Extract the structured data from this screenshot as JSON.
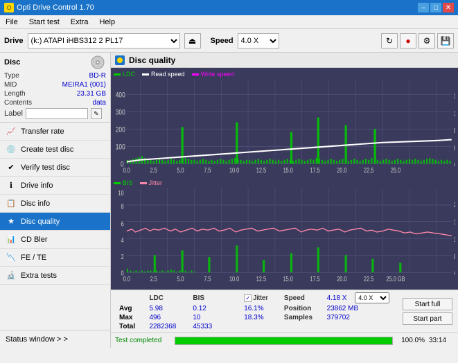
{
  "app": {
    "title": "Opti Drive Control 1.70",
    "icon": "disc"
  },
  "titlebar": {
    "title": "Opti Drive Control 1.70",
    "minimize": "–",
    "maximize": "□",
    "close": "✕"
  },
  "menubar": {
    "items": [
      "File",
      "Start test",
      "Extra",
      "Help"
    ]
  },
  "toolbar": {
    "drive_label": "Drive",
    "drive_value": "(k:) ATAPI iHBS312  2 PL17",
    "speed_label": "Speed",
    "speed_value": "4.0 X",
    "start_test_label": "Start test"
  },
  "disc": {
    "title": "Disc",
    "type_label": "Type",
    "type_value": "BD-R",
    "mid_label": "MID",
    "mid_value": "MEIRA1 (001)",
    "length_label": "Length",
    "length_value": "23.31 GB",
    "contents_label": "Contents",
    "contents_value": "data",
    "label_label": "Label",
    "label_value": ""
  },
  "sidebar": {
    "items": [
      {
        "id": "transfer-rate",
        "label": "Transfer rate",
        "icon": "📈"
      },
      {
        "id": "create-test-disc",
        "label": "Create test disc",
        "icon": "💿"
      },
      {
        "id": "verify-test-disc",
        "label": "Verify test disc",
        "icon": "✔"
      },
      {
        "id": "drive-info",
        "label": "Drive info",
        "icon": "ℹ"
      },
      {
        "id": "disc-info",
        "label": "Disc info",
        "icon": "📋"
      },
      {
        "id": "disc-quality",
        "label": "Disc quality",
        "icon": "★",
        "active": true
      },
      {
        "id": "cd-bler",
        "label": "CD Bler",
        "icon": "📊"
      },
      {
        "id": "fe-te",
        "label": "FE / TE",
        "icon": "📉"
      },
      {
        "id": "extra-tests",
        "label": "Extra tests",
        "icon": "🔬"
      }
    ],
    "status_window": "Status window > >"
  },
  "disc_quality": {
    "title": "Disc quality",
    "legend_upper": [
      {
        "label": "LDC",
        "color": "#00cc00"
      },
      {
        "label": "Read speed",
        "color": "#ffffff"
      },
      {
        "label": "Write speed",
        "color": "#ff00ff"
      }
    ],
    "legend_lower": [
      {
        "label": "BIS",
        "color": "#00cc00"
      },
      {
        "label": "Jitter",
        "color": "#ff88aa"
      }
    ],
    "upper_ymax": 500,
    "upper_yright": 18,
    "lower_ymax": 10,
    "lower_yright": 20,
    "xmax": 25.0
  },
  "stats": {
    "headers": [
      "",
      "LDC",
      "BIS",
      "",
      "Jitter",
      "Speed",
      "",
      ""
    ],
    "avg_label": "Avg",
    "avg_ldc": "5.98",
    "avg_bis": "0.12",
    "avg_jitter": "16.1%",
    "max_label": "Max",
    "max_ldc": "496",
    "max_bis": "10",
    "max_jitter": "18.3%",
    "total_label": "Total",
    "total_ldc": "2282368",
    "total_bis": "45333",
    "speed_label": "Speed",
    "speed_value": "4.18 X",
    "speed_select": "4.0 X",
    "position_label": "Position",
    "position_value": "23862 MB",
    "samples_label": "Samples",
    "samples_value": "379702",
    "jitter_checked": true,
    "jitter_label": "Jitter",
    "start_full_label": "Start full",
    "start_part_label": "Start part"
  },
  "progress": {
    "percent": 100.0,
    "percent_text": "100.0%",
    "time": "33:14",
    "status": "Test completed"
  },
  "colors": {
    "active_blue": "#1a73c8",
    "chart_bg": "#3a3a5c",
    "green": "#00cc00",
    "white_line": "#ffffff",
    "magenta_line": "#ff00ff",
    "pink_line": "#ff88aa",
    "grid": "#555580"
  }
}
